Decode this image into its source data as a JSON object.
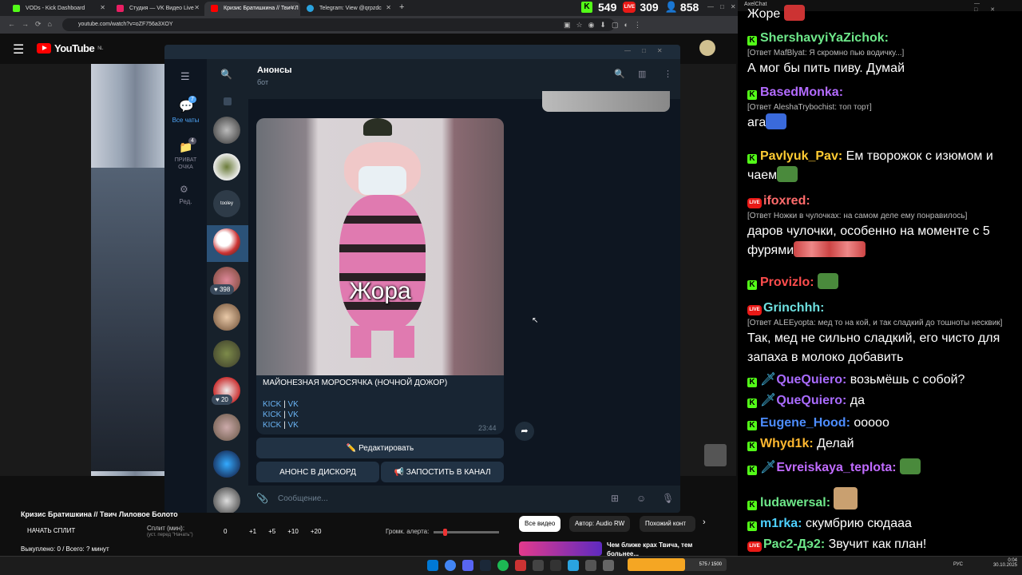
{
  "browser": {
    "tabs": [
      {
        "title": "VODs - Kick Dashboard",
        "color": "#53fc18"
      },
      {
        "title": "Студия — VK Видео Live",
        "color": "#e91e63"
      },
      {
        "title": "Кризис Братишкина // Твич Л",
        "color": "#ff0000"
      },
      {
        "title": "Telegram: View @qrpzdc",
        "color": "#2aa3df"
      }
    ],
    "url": "youtube.com/watch?v=oZF756a3XOY",
    "stats": {
      "kick": "549",
      "vk": "309",
      "viewers": "858"
    }
  },
  "youtube": {
    "logo": "YouTube",
    "region": "NL",
    "video_title": "Кризис Братишкина // Твич Лиловое Болото",
    "split_button": "НАЧАТЬ СПЛИТ",
    "split_label": "Сплит (мин):",
    "split_hint": "(уст. перед \"Начать\")",
    "split_value": "0",
    "increments": [
      "+1",
      "+5",
      "+10",
      "+20"
    ],
    "alert_label": "Громк. алерта:",
    "paid_out": "Выкуплено: 0 / Всего: ? минут",
    "chips": [
      "Все видео",
      "Автор: Audio RW",
      "Похожий конт"
    ],
    "rec_title": "Чем ближе крах Твича, тем",
    "rec_title2": "больнее..."
  },
  "telegram": {
    "folders": [
      {
        "label": "Все чаты",
        "badge": "7"
      },
      {
        "label": "ПРИВАТ ОЧКА",
        "badge": "4"
      },
      {
        "label": "Ред.",
        "badge": ""
      }
    ],
    "chat_badges": [
      "398",
      "20"
    ],
    "chat_title": "Анонсы",
    "chat_subtitle": "бот",
    "image_caption": "Жора",
    "message_title": "МАЙОНЕЗНАЯ МОРОСЯЧКА (НОЧНОЙ ДОЖОР)",
    "links": [
      {
        "a": "KICK",
        "b": "VK"
      },
      {
        "a": "KICK",
        "b": "VK"
      },
      {
        "a": "KICK",
        "b": "VK"
      }
    ],
    "time": "23:44",
    "edit_button": "✏️ Редактировать",
    "discord_button": "АНОНС В ДИСКОРД",
    "channel_button": "📢 ЗАПОСТИТЬ В КАНАЛ",
    "input_placeholder": "Сообщение..."
  },
  "chat": {
    "window_title": "AxelChat",
    "messages": [
      {
        "platform": "",
        "nick": "",
        "color": "#fff",
        "reply": "",
        "text": "Жоре"
      },
      {
        "platform": "kick",
        "nick": "ShershavyiYaZichok:",
        "color": "#6ee88a",
        "reply": "[Ответ MafBlyat: Я скромно пью водичку...]",
        "text": "А мог бы пить пиву. Думай"
      },
      {
        "platform": "kick",
        "nick": "BasedMonka:",
        "color": "#b36bff",
        "reply": "[Ответ AleshaTrybochist: топ торт]",
        "text": "ага"
      },
      {
        "platform": "kick",
        "nick": "Pavlyuk_Pav:",
        "color": "#ffcc33",
        "reply": "",
        "text": "Ем творожок с изюмом и чаем"
      },
      {
        "platform": "vk",
        "nick": "ifoxred:",
        "color": "#ff6b6b",
        "reply": "[Ответ Ножки в чулочках: на самом деле ему понравилось]",
        "text": "даров чулочки, особенно на моменте с 5 фурями"
      },
      {
        "platform": "kick",
        "nick": "Provizlo:",
        "color": "#ff4d4d",
        "reply": "",
        "text": ""
      },
      {
        "platform": "vk",
        "nick": "Grinchhh:",
        "color": "#6ee0e0",
        "reply": "[Ответ ALEEyopta: мед то на кой, и так сладкий до тошноты несквик]",
        "text": "Так, мед не сильно сладкий, его чисто для запаха в молоко добавить"
      },
      {
        "platform": "kick",
        "nick": "QueQuiero:",
        "color": "#a96bff",
        "reply": "",
        "text": "возьмёшь с собой?"
      },
      {
        "platform": "kick",
        "nick": "QueQuiero:",
        "color": "#a96bff",
        "reply": "",
        "text": "да"
      },
      {
        "platform": "kick",
        "nick": "Eugene_Hood:",
        "color": "#4d8dff",
        "reply": "",
        "text": "ооооо"
      },
      {
        "platform": "kick",
        "nick": "Whyd1k:",
        "color": "#ffb830",
        "reply": "",
        "text": "Делай"
      },
      {
        "platform": "kick",
        "nick": "Evreiskaya_teplota:",
        "color": "#c06bff",
        "reply": "",
        "text": ""
      },
      {
        "platform": "kick",
        "nick": "ludawersal:",
        "color": "#6ee88a",
        "reply": "",
        "text": ""
      },
      {
        "platform": "kick",
        "nick": "m1rka:",
        "color": "#4dd0ff",
        "reply": "",
        "text": "скумбрию сюдааа"
      },
      {
        "platform": "vk",
        "nick": "Pac2-Дэ2:",
        "color": "#6ee88a",
        "reply": "",
        "text": "Звучит как план!"
      }
    ]
  },
  "taskbar": {
    "lang": "РУС",
    "time": "0:04",
    "date": "30.10.2025",
    "widget": "575 / 1500"
  }
}
